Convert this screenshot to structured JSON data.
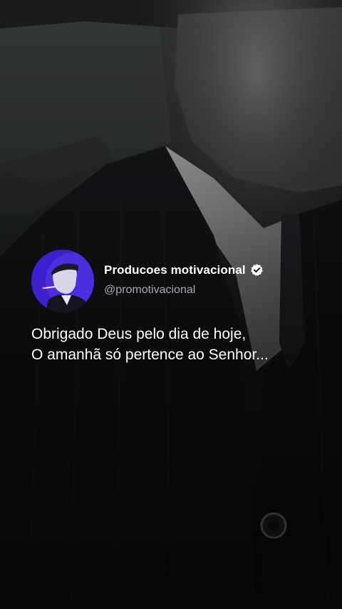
{
  "post": {
    "account_name": "Producoes motivacional",
    "verified_icon": "verified-check-icon",
    "handle": "@promotivacional",
    "message_lines": [
      "Obrigado Deus pelo dia de hoje,",
      "O amanhã só pertence ao Senhor..."
    ]
  },
  "colors": {
    "avatar_bg": "#3b1fd1",
    "text": "#ffffff",
    "handle": "#a9a9ad"
  }
}
